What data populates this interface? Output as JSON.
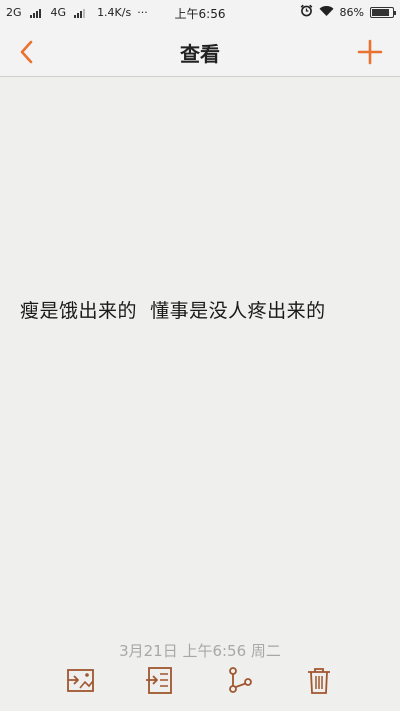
{
  "status_bar": {
    "carrier1": "2G",
    "carrier2": "4G",
    "speed": "1.4K/s",
    "dots": "···",
    "time": "上午6:56",
    "battery": "86%",
    "battery_level": 0.86
  },
  "header": {
    "title": "查看",
    "back_icon": "chevron-left-icon",
    "add_icon": "plus-icon"
  },
  "note": {
    "content": "瘦是饿出来的  懂事是没人疼出来的",
    "date": "3月21日 上午6:56 周二"
  },
  "toolbar": {
    "items": [
      {
        "icon": "export-image-icon"
      },
      {
        "icon": "export-text-icon"
      },
      {
        "icon": "share-icon"
      },
      {
        "icon": "trash-icon"
      }
    ]
  },
  "colors": {
    "accent": "#e8722f",
    "icon_brown": "#a0562f",
    "date_gray": "#a8a8a8"
  }
}
